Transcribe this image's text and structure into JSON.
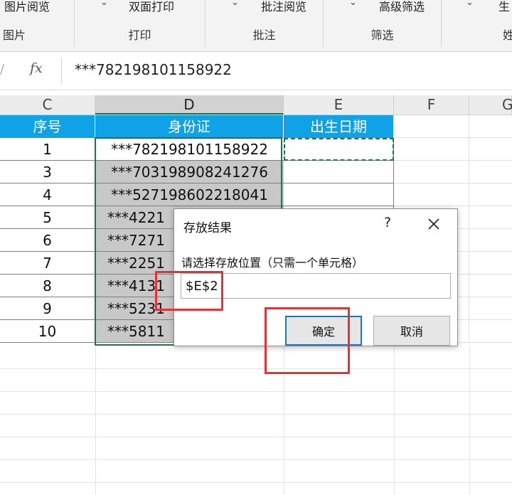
{
  "ribbon": {
    "groups": [
      {
        "top_label": "图片阅览",
        "name": "图片"
      },
      {
        "top_label": "双面打印",
        "name": "打印"
      },
      {
        "top_label": "批注阅览",
        "name": "批注"
      },
      {
        "top_label": "高级筛选",
        "name": "筛选"
      },
      {
        "top_label": "生",
        "name": "姓"
      }
    ]
  },
  "formula_bar": {
    "fx_label": "fx",
    "content": "***782198101158922"
  },
  "columns": [
    "C",
    "D",
    "E",
    "F",
    "G"
  ],
  "table": {
    "headers": [
      "序号",
      "身份证",
      "出生日期"
    ],
    "rows": [
      {
        "seq": "1",
        "id": "***782198101158922"
      },
      {
        "seq": "3",
        "id": "***703198908241276"
      },
      {
        "seq": "4",
        "id": "***527198602218041"
      },
      {
        "seq": "5",
        "id": "***4221"
      },
      {
        "seq": "6",
        "id": "***7271"
      },
      {
        "seq": "7",
        "id": "***2251"
      },
      {
        "seq": "8",
        "id": "***4131"
      },
      {
        "seq": "9",
        "id": "***5231"
      },
      {
        "seq": "10",
        "id": "***5811"
      }
    ]
  },
  "dialog": {
    "title": "存放结果",
    "help": "?",
    "prompt": "请选择存放位置（只需一个单元格）",
    "input_value": "$E$2",
    "ok_label": "确定",
    "cancel_label": "取消"
  },
  "colors": {
    "header_fill": "#10a2e6",
    "selection_green": "#217346",
    "highlight_red": "#e0343a",
    "ok_border": "#1e74c8"
  }
}
